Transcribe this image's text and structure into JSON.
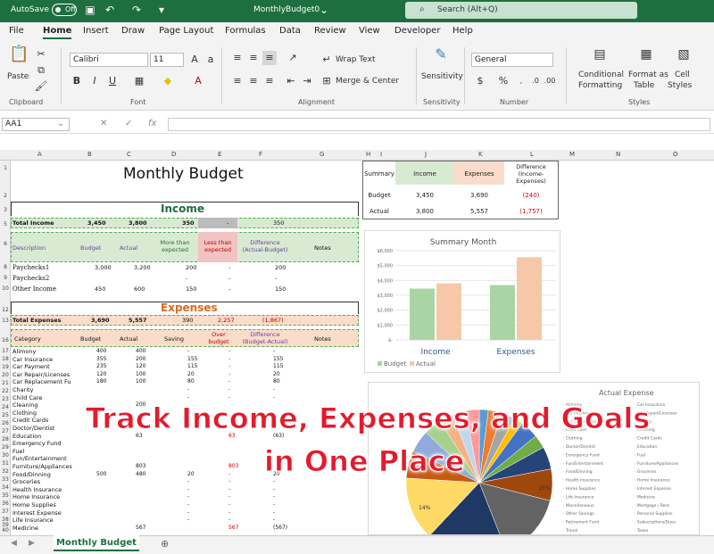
{
  "titlebar": {
    "autosave": "AutoSave",
    "toggle": "Off",
    "doc_title": "MonthlyBudget0",
    "search": "Search (Alt+Q)"
  },
  "menu": [
    "File",
    "Home",
    "Insert",
    "Draw",
    "Page Layout",
    "Formulas",
    "Data",
    "Review",
    "View",
    "Developer",
    "Help"
  ],
  "ribbon": {
    "paste": "Paste",
    "clipboard": "Clipboard",
    "font_name": "Calibri",
    "font_size": "11",
    "font": "Font",
    "wrap": "Wrap Text",
    "merge": "Merge & Center",
    "alignment": "Alignment",
    "sensitivity": "Sensitivity",
    "sensitivity_grp": "Sensitivity",
    "number_format": "General",
    "number": "Number",
    "cond1": "Conditional",
    "cond2": "Formatting",
    "fmt1": "Format as",
    "fmt2": "Table",
    "cell1": "Cell",
    "cell2": "Styles",
    "styles": "Styles",
    "bold": "B",
    "italic": "I",
    "underline": "U",
    "currency": "$",
    "percent": "%"
  },
  "formula": {
    "namebox": "AA1",
    "fx": "fx"
  },
  "columns": [
    "A",
    "B",
    "C",
    "D",
    "E",
    "F",
    "G",
    "H",
    "I",
    "J",
    "K",
    "L",
    "M",
    "N",
    "O"
  ],
  "rows": [
    "1",
    "2",
    "3",
    "5",
    "6",
    "8",
    "9",
    "10",
    "12",
    "13",
    "16",
    "17",
    "18",
    "19",
    "20",
    "21",
    "22",
    "23",
    "24",
    "25",
    "26",
    "27",
    "28",
    "29",
    "30",
    "31",
    "32",
    "33",
    "34",
    "35",
    "36",
    "37",
    "38",
    "39",
    "40"
  ],
  "budget": {
    "title": "Monthly Budget",
    "income_hdr": "Income",
    "total_income": {
      "label": "Total Income",
      "budget": "3,450",
      "actual": "3,800",
      "more": "350",
      "less": "-",
      "diff": "350"
    },
    "inc_cols": [
      "Description",
      "Budget",
      "Actual",
      "More than expected",
      "Less than expected",
      "Difference (Actual-Budget)",
      "Notes"
    ],
    "income_rows": [
      {
        "label": "Paychecks1",
        "budget": "3,000",
        "actual": "3,200",
        "more": "200",
        "less": "-",
        "diff": "200"
      },
      {
        "label": "Paychecks2",
        "budget": "",
        "actual": "",
        "more": "-",
        "less": "-",
        "diff": "-"
      },
      {
        "label": "Other Income",
        "budget": "450",
        "actual": "600",
        "more": "150",
        "less": "-",
        "diff": "150"
      }
    ],
    "expenses_hdr": "Expenses",
    "total_exp": {
      "label": "Total Expenses",
      "budget": "3,690",
      "actual": "5,557",
      "saving": "390",
      "over": "2,257",
      "diff": "(1,867)"
    },
    "exp_cols": [
      "Category",
      "Budget",
      "Actual",
      "Saving",
      "Over budget",
      "Difference (Budget-Actual)",
      "Notes"
    ],
    "exp_rows": [
      {
        "label": "Alimony",
        "budget": "400",
        "actual": "400",
        "saving": "-",
        "over": "-",
        "diff": "-"
      },
      {
        "label": "Car Insurance",
        "budget": "355",
        "actual": "200",
        "saving": "155",
        "over": "-",
        "diff": "155"
      },
      {
        "label": "Car Payment",
        "budget": "235",
        "actual": "120",
        "saving": "115",
        "over": "-",
        "diff": "115"
      },
      {
        "label": "Car Repair/Licenses",
        "budget": "120",
        "actual": "100",
        "saving": "20",
        "over": "-",
        "diff": "20"
      },
      {
        "label": "Car Replacement Fu",
        "budget": "180",
        "actual": "100",
        "saving": "80",
        "over": "-",
        "diff": "80"
      },
      {
        "label": "Charity",
        "budget": "",
        "actual": "",
        "saving": "-",
        "over": "-",
        "diff": "-"
      },
      {
        "label": "Child Care",
        "budget": "",
        "actual": "",
        "saving": "-",
        "over": "-",
        "diff": "-"
      },
      {
        "label": "Cleaning",
        "budget": "",
        "actual": "200",
        "saving": "",
        "over": "",
        "diff": ""
      },
      {
        "label": "Clothing",
        "budget": "",
        "actual": "",
        "saving": "",
        "over": "",
        "diff": ""
      },
      {
        "label": "Credit Cards",
        "budget": "",
        "actual": "",
        "saving": "",
        "over": "",
        "diff": ""
      },
      {
        "label": "Doctor/Dentist",
        "budget": "",
        "actual": "",
        "saving": "",
        "over": "",
        "diff": ""
      },
      {
        "label": "Education",
        "budget": "",
        "actual": "63",
        "saving": "",
        "over": "63",
        "diff": "(63)"
      },
      {
        "label": "Emergency Fund",
        "budget": "",
        "actual": "",
        "saving": "",
        "over": "",
        "diff": ""
      },
      {
        "label": "Fuel",
        "budget": "",
        "actual": "",
        "saving": "",
        "over": "",
        "diff": ""
      },
      {
        "label": "Fun/Entertainment",
        "budget": "",
        "actual": "",
        "saving": "",
        "over": "",
        "diff": ""
      },
      {
        "label": "Furniture/Appliances",
        "budget": "",
        "actual": "803",
        "saving": "",
        "over": "803",
        "diff": ""
      },
      {
        "label": "Food/Dinning",
        "budget": "500",
        "actual": "480",
        "saving": "20",
        "over": "-",
        "diff": "20"
      },
      {
        "label": "Groceries",
        "budget": "",
        "actual": "",
        "saving": "-",
        "over": "-",
        "diff": "-"
      },
      {
        "label": "Health Insurance",
        "budget": "",
        "actual": "",
        "saving": "-",
        "over": "-",
        "diff": "-"
      },
      {
        "label": "Home Insurance",
        "budget": "",
        "actual": "",
        "saving": "-",
        "over": "-",
        "diff": "-"
      },
      {
        "label": "Home Supplies",
        "budget": "",
        "actual": "",
        "saving": "-",
        "over": "-",
        "diff": "-"
      },
      {
        "label": "Interest Expense",
        "budget": "",
        "actual": "",
        "saving": "-",
        "over": "-",
        "diff": "-"
      },
      {
        "label": "Life Insurance",
        "budget": "",
        "actual": "",
        "saving": "-",
        "over": "-",
        "diff": "-"
      },
      {
        "label": "Medicine",
        "budget": "",
        "actual": "567",
        "saving": "",
        "over": "567",
        "diff": "(567)"
      }
    ]
  },
  "summary": {
    "hdr": [
      "Summary",
      "Income",
      "Expenses",
      "Difference (Income-Expenses)"
    ],
    "rows": [
      {
        "label": "Budget",
        "income": "3,450",
        "expenses": "3,690",
        "diff": "(240)"
      },
      {
        "label": "Actual",
        "income": "3,800",
        "expenses": "5,557",
        "diff": "(1,757)"
      }
    ]
  },
  "chart_data": [
    {
      "type": "bar",
      "title": "Summary Month",
      "categories": [
        "Income",
        "Expenses"
      ],
      "series": [
        {
          "name": "Budget",
          "values": [
            3450,
            3690
          ]
        },
        {
          "name": "Actual",
          "values": [
            3800,
            5557
          ]
        }
      ],
      "ylim": [
        0,
        6000
      ],
      "yticks": [
        "$-",
        "$1,000",
        "$2,000",
        "$3,000",
        "$4,000",
        "$5,000",
        "$6,000"
      ],
      "colors": {
        "Budget": "#a9d5a4",
        "Actual": "#f6c8a8"
      },
      "legend": "bottom-left"
    },
    {
      "type": "pie",
      "title": "Actual Expense",
      "slice_labels": [
        "15%",
        "14%"
      ],
      "legend_col1": [
        "Alimony",
        "Car Payment",
        "Car Replacement Fund",
        "Child Care",
        "Clothing",
        "Doctor/Dentist",
        "Emergency Fund",
        "Fun/Entertainment",
        "Food/Dinning",
        "Health Insurance",
        "Home Supplies",
        "Life Insurance",
        "Miscellaneous",
        "Other Savings",
        "Retirement Fund",
        "Travel"
      ],
      "legend_col2": [
        "Car Insurance",
        "Car Repair/Licenses",
        "Charity",
        "Cleaning",
        "Credit Cards",
        "Education",
        "Fuel",
        "Furniture/Appliances",
        "Groceries",
        "Home Insurance",
        "Interest Expense",
        "Medicine",
        "Mortgage / Rent",
        "Personal Supplies",
        "Subscriptions/Dues",
        "Taxes"
      ]
    }
  ],
  "overlay": {
    "line1": "Track Income, Expenses, and Goals",
    "line2": "in One Place"
  },
  "sheet_tab": "Monthly Budget",
  "colors": {
    "excel_green": "#1e6f3f",
    "income_band": "#d8ead2",
    "expense_band": "#f9dcc9",
    "over_band": "#f1c3c3",
    "dash": "#4caf50"
  }
}
